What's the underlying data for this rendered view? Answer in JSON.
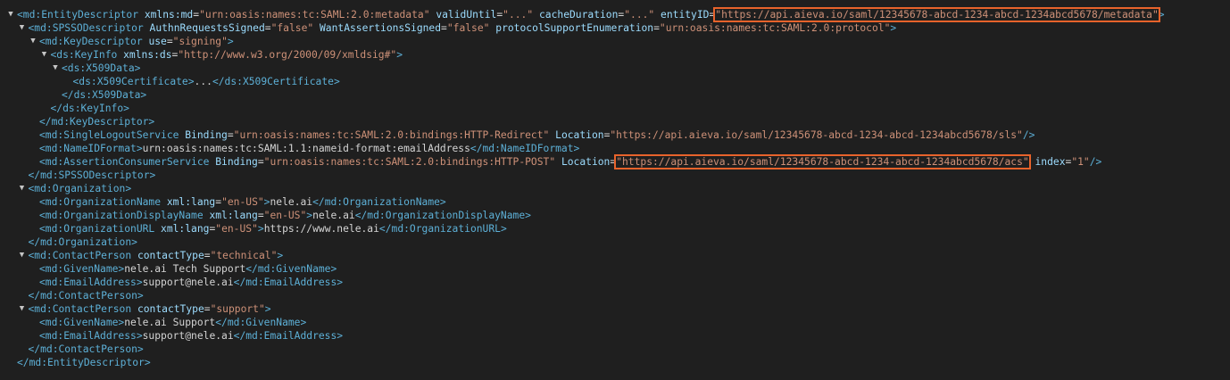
{
  "hl_color": "#e8632b",
  "toggle_icon": "expand-triangle-icon",
  "lines": [
    {
      "indent": 0,
      "toggle": true,
      "parts": [
        {
          "t": "tag",
          "v": "<md:EntityDescriptor "
        },
        {
          "t": "aname",
          "v": "xmlns:md"
        },
        {
          "t": "txt",
          "v": "="
        },
        {
          "t": "aval",
          "v": "\"urn:oasis:names:tc:SAML:2.0:metadata\""
        },
        {
          "t": "txt",
          "v": " "
        },
        {
          "t": "aname",
          "v": "validUntil"
        },
        {
          "t": "txt",
          "v": "="
        },
        {
          "t": "aval",
          "v": "\"...\""
        },
        {
          "t": "txt",
          "v": " "
        },
        {
          "t": "aname",
          "v": "cacheDuration"
        },
        {
          "t": "txt",
          "v": "="
        },
        {
          "t": "aval",
          "v": "\"...\""
        },
        {
          "t": "txt",
          "v": " "
        },
        {
          "t": "aname",
          "v": "entityID"
        },
        {
          "t": "txt",
          "v": "="
        },
        {
          "t": "aval",
          "v": "\"https://api.aieva.io/saml/12345678-abcd-1234-abcd-1234abcd5678/metadata\"",
          "hl": true
        },
        {
          "t": "tag",
          "v": ">"
        }
      ]
    },
    {
      "indent": 1,
      "toggle": true,
      "parts": [
        {
          "t": "tag",
          "v": "<md:SPSSODescriptor "
        },
        {
          "t": "aname",
          "v": "AuthnRequestsSigned"
        },
        {
          "t": "txt",
          "v": "="
        },
        {
          "t": "aval",
          "v": "\"false\""
        },
        {
          "t": "txt",
          "v": " "
        },
        {
          "t": "aname",
          "v": "WantAssertionsSigned"
        },
        {
          "t": "txt",
          "v": "="
        },
        {
          "t": "aval",
          "v": "\"false\""
        },
        {
          "t": "txt",
          "v": " "
        },
        {
          "t": "aname",
          "v": "protocolSupportEnumeration"
        },
        {
          "t": "txt",
          "v": "="
        },
        {
          "t": "aval",
          "v": "\"urn:oasis:names:tc:SAML:2.0:protocol\""
        },
        {
          "t": "tag",
          "v": ">"
        }
      ]
    },
    {
      "indent": 2,
      "toggle": true,
      "parts": [
        {
          "t": "tag",
          "v": "<md:KeyDescriptor "
        },
        {
          "t": "aname",
          "v": "use"
        },
        {
          "t": "txt",
          "v": "="
        },
        {
          "t": "aval",
          "v": "\"signing\""
        },
        {
          "t": "tag",
          "v": ">"
        }
      ]
    },
    {
      "indent": 3,
      "toggle": true,
      "parts": [
        {
          "t": "tag",
          "v": "<ds:KeyInfo "
        },
        {
          "t": "aname",
          "v": "xmlns:ds"
        },
        {
          "t": "txt",
          "v": "="
        },
        {
          "t": "aval",
          "v": "\"http://www.w3.org/2000/09/xmldsig#\""
        },
        {
          "t": "tag",
          "v": ">"
        }
      ]
    },
    {
      "indent": 4,
      "toggle": true,
      "parts": [
        {
          "t": "tag",
          "v": "<ds:X509Data>"
        }
      ]
    },
    {
      "indent": 5,
      "toggle": false,
      "parts": [
        {
          "t": "tag",
          "v": "<ds:X509Certificate>"
        },
        {
          "t": "txt",
          "v": "..."
        },
        {
          "t": "tag",
          "v": "</ds:X509Certificate>"
        }
      ]
    },
    {
      "indent": 4,
      "toggle": false,
      "parts": [
        {
          "t": "tag",
          "v": "</ds:X509Data>"
        }
      ]
    },
    {
      "indent": 3,
      "toggle": false,
      "parts": [
        {
          "t": "tag",
          "v": "</ds:KeyInfo>"
        }
      ]
    },
    {
      "indent": 2,
      "toggle": false,
      "parts": [
        {
          "t": "tag",
          "v": "</md:KeyDescriptor>"
        }
      ]
    },
    {
      "indent": 2,
      "toggle": false,
      "parts": [
        {
          "t": "tag",
          "v": "<md:SingleLogoutService "
        },
        {
          "t": "aname",
          "v": "Binding"
        },
        {
          "t": "txt",
          "v": "="
        },
        {
          "t": "aval",
          "v": "\"urn:oasis:names:tc:SAML:2.0:bindings:HTTP-Redirect\""
        },
        {
          "t": "txt",
          "v": " "
        },
        {
          "t": "aname",
          "v": "Location"
        },
        {
          "t": "txt",
          "v": "="
        },
        {
          "t": "aval",
          "v": "\"https://api.aieva.io/saml/12345678-abcd-1234-abcd-1234abcd5678/sls\""
        },
        {
          "t": "tag",
          "v": "/>"
        }
      ]
    },
    {
      "indent": 2,
      "toggle": false,
      "parts": [
        {
          "t": "tag",
          "v": "<md:NameIDFormat>"
        },
        {
          "t": "txt",
          "v": "urn:oasis:names:tc:SAML:1.1:nameid-format:emailAddress"
        },
        {
          "t": "tag",
          "v": "</md:NameIDFormat>"
        }
      ]
    },
    {
      "indent": 2,
      "toggle": false,
      "parts": [
        {
          "t": "tag",
          "v": "<md:AssertionConsumerService "
        },
        {
          "t": "aname",
          "v": "Binding"
        },
        {
          "t": "txt",
          "v": "="
        },
        {
          "t": "aval",
          "v": "\"urn:oasis:names:tc:SAML:2.0:bindings:HTTP-POST\""
        },
        {
          "t": "txt",
          "v": " "
        },
        {
          "t": "aname",
          "v": "Location"
        },
        {
          "t": "txt",
          "v": "="
        },
        {
          "t": "aval",
          "v": "\"https://api.aieva.io/saml/12345678-abcd-1234-abcd-1234abcd5678/acs\"",
          "hl": true
        },
        {
          "t": "txt",
          "v": " "
        },
        {
          "t": "aname",
          "v": "index"
        },
        {
          "t": "txt",
          "v": "="
        },
        {
          "t": "aval",
          "v": "\"1\""
        },
        {
          "t": "tag",
          "v": "/>"
        }
      ]
    },
    {
      "indent": 1,
      "toggle": false,
      "parts": [
        {
          "t": "tag",
          "v": "</md:SPSSODescriptor>"
        }
      ]
    },
    {
      "indent": 1,
      "toggle": true,
      "parts": [
        {
          "t": "tag",
          "v": "<md:Organization>"
        }
      ]
    },
    {
      "indent": 2,
      "toggle": false,
      "parts": [
        {
          "t": "tag",
          "v": "<md:OrganizationName "
        },
        {
          "t": "aname",
          "v": "xml:lang"
        },
        {
          "t": "txt",
          "v": "="
        },
        {
          "t": "aval",
          "v": "\"en-US\""
        },
        {
          "t": "tag",
          "v": ">"
        },
        {
          "t": "txt",
          "v": "nele.ai"
        },
        {
          "t": "tag",
          "v": "</md:OrganizationName>"
        }
      ]
    },
    {
      "indent": 2,
      "toggle": false,
      "parts": [
        {
          "t": "tag",
          "v": "<md:OrganizationDisplayName "
        },
        {
          "t": "aname",
          "v": "xml:lang"
        },
        {
          "t": "txt",
          "v": "="
        },
        {
          "t": "aval",
          "v": "\"en-US\""
        },
        {
          "t": "tag",
          "v": ">"
        },
        {
          "t": "txt",
          "v": "nele.ai"
        },
        {
          "t": "tag",
          "v": "</md:OrganizationDisplayName>"
        }
      ]
    },
    {
      "indent": 2,
      "toggle": false,
      "parts": [
        {
          "t": "tag",
          "v": "<md:OrganizationURL "
        },
        {
          "t": "aname",
          "v": "xml:lang"
        },
        {
          "t": "txt",
          "v": "="
        },
        {
          "t": "aval",
          "v": "\"en-US\""
        },
        {
          "t": "tag",
          "v": ">"
        },
        {
          "t": "txt",
          "v": "https://www.nele.ai"
        },
        {
          "t": "tag",
          "v": "</md:OrganizationURL>"
        }
      ]
    },
    {
      "indent": 1,
      "toggle": false,
      "parts": [
        {
          "t": "tag",
          "v": "</md:Organization>"
        }
      ]
    },
    {
      "indent": 1,
      "toggle": true,
      "parts": [
        {
          "t": "tag",
          "v": "<md:ContactPerson "
        },
        {
          "t": "aname",
          "v": "contactType"
        },
        {
          "t": "txt",
          "v": "="
        },
        {
          "t": "aval",
          "v": "\"technical\""
        },
        {
          "t": "tag",
          "v": ">"
        }
      ]
    },
    {
      "indent": 2,
      "toggle": false,
      "parts": [
        {
          "t": "tag",
          "v": "<md:GivenName>"
        },
        {
          "t": "txt",
          "v": "nele.ai Tech Support"
        },
        {
          "t": "tag",
          "v": "</md:GivenName>"
        }
      ]
    },
    {
      "indent": 2,
      "toggle": false,
      "parts": [
        {
          "t": "tag",
          "v": "<md:EmailAddress>"
        },
        {
          "t": "txt",
          "v": "support@nele.ai"
        },
        {
          "t": "tag",
          "v": "</md:EmailAddress>"
        }
      ]
    },
    {
      "indent": 1,
      "toggle": false,
      "parts": [
        {
          "t": "tag",
          "v": "</md:ContactPerson>"
        }
      ]
    },
    {
      "indent": 1,
      "toggle": true,
      "parts": [
        {
          "t": "tag",
          "v": "<md:ContactPerson "
        },
        {
          "t": "aname",
          "v": "contactType"
        },
        {
          "t": "txt",
          "v": "="
        },
        {
          "t": "aval",
          "v": "\"support\""
        },
        {
          "t": "tag",
          "v": ">"
        }
      ]
    },
    {
      "indent": 2,
      "toggle": false,
      "parts": [
        {
          "t": "tag",
          "v": "<md:GivenName>"
        },
        {
          "t": "txt",
          "v": "nele.ai Support"
        },
        {
          "t": "tag",
          "v": "</md:GivenName>"
        }
      ]
    },
    {
      "indent": 2,
      "toggle": false,
      "parts": [
        {
          "t": "tag",
          "v": "<md:EmailAddress>"
        },
        {
          "t": "txt",
          "v": "support@nele.ai"
        },
        {
          "t": "tag",
          "v": "</md:EmailAddress>"
        }
      ]
    },
    {
      "indent": 1,
      "toggle": false,
      "parts": [
        {
          "t": "tag",
          "v": "</md:ContactPerson>"
        }
      ]
    },
    {
      "indent": 0,
      "toggle": false,
      "parts": [
        {
          "t": "tag",
          "v": "</md:EntityDescriptor>"
        }
      ]
    }
  ]
}
